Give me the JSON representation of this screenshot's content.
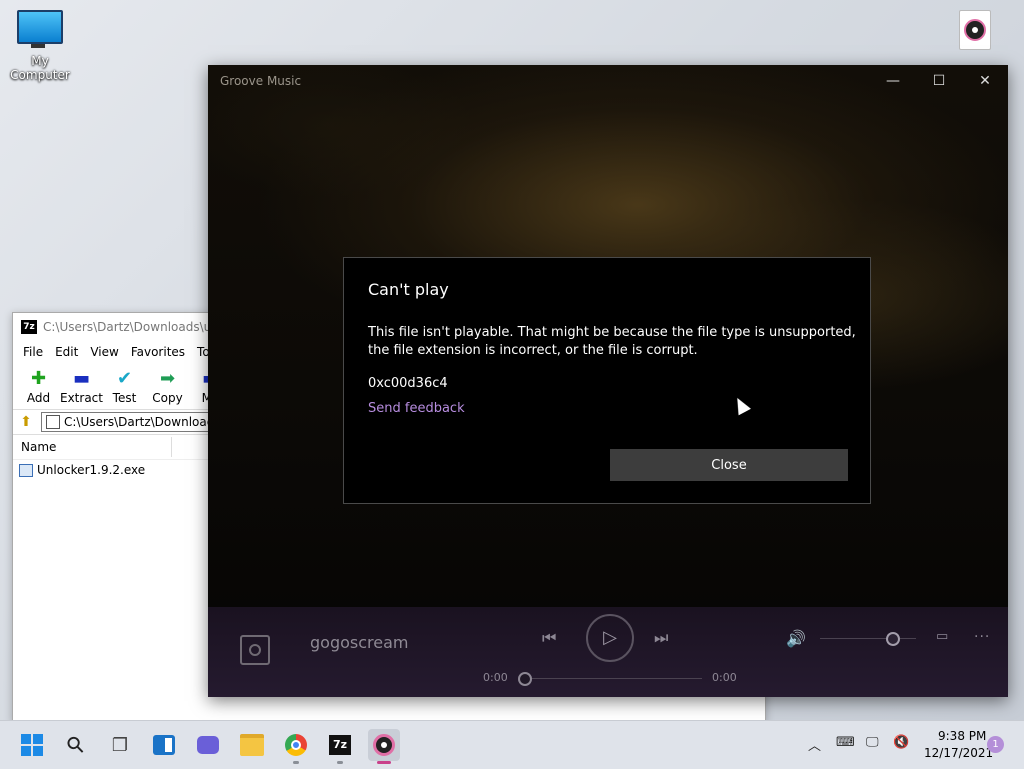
{
  "desktop": {
    "my_computer_label": "My Computer"
  },
  "zip_window": {
    "title": "C:\\Users\\Dartz\\Downloads\\unlo",
    "icon_text": "7z",
    "menu": [
      "File",
      "Edit",
      "View",
      "Favorites",
      "Tool"
    ],
    "toolbar": [
      {
        "label": "Add",
        "icon": "plus-icon",
        "glyph": "✚",
        "color": "#1fa31f"
      },
      {
        "label": "Extract",
        "icon": "minus-icon",
        "glyph": "▬",
        "color": "#1a2fbf"
      },
      {
        "label": "Test",
        "icon": "check-icon",
        "glyph": "✔",
        "color": "#1aa8c8"
      },
      {
        "label": "Copy",
        "icon": "copy-arrow-icon",
        "glyph": "➡",
        "color": "#1f9d55"
      },
      {
        "label": "Mo",
        "icon": "move-icon",
        "glyph": "▬",
        "color": "#1a2fbf"
      }
    ],
    "address": "C:\\Users\\Dartz\\Downloads",
    "column_name": "Name",
    "files": [
      "Unlocker1.9.2.exe"
    ]
  },
  "groove": {
    "app_title": "Groove Music",
    "min_glyph": "—",
    "max_glyph": "☐",
    "close_glyph": "✕",
    "song_title": "gogoscream",
    "prev_glyph": "⏮",
    "play_glyph": "▷",
    "next_glyph": "⏭",
    "time_start": "0:00",
    "time_end": "0:00",
    "volume_glyph": "🔊",
    "mini_glyph": "▭",
    "more_glyph": "···"
  },
  "dialog": {
    "title": "Can't play",
    "message": "This file isn't playable. That might be because the file type is unsupported, the file extension is incorrect, or the file is corrupt.",
    "error_code": "0xc00d36c4",
    "feedback_link": "Send feedback",
    "close_label": "Close"
  },
  "taskbar": {
    "search_glyph": "⚲",
    "taskview_glyph": "❐",
    "tray_chevron": "︿",
    "tray_keyboard": "⌨",
    "tray_network": "🖵",
    "tray_volume": "🔇",
    "time": "9:38 PM",
    "date": "12/17/2021",
    "notifications": "1"
  }
}
